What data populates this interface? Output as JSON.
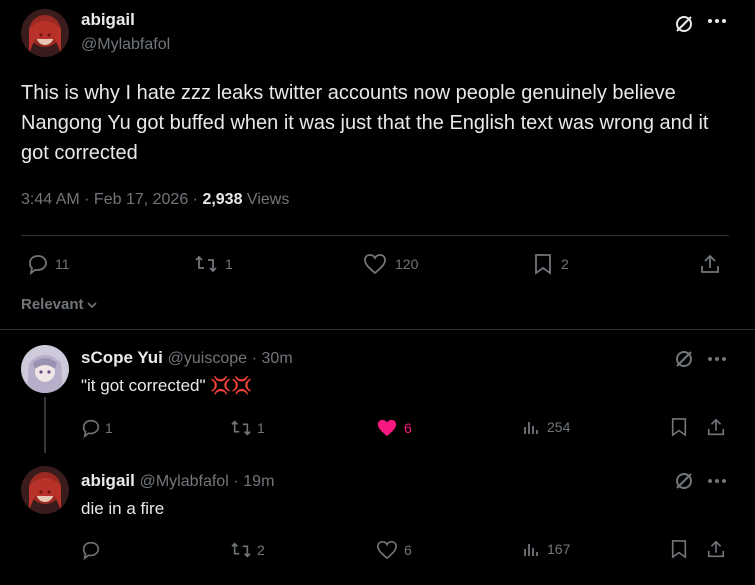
{
  "main_post": {
    "author_name": "abigail",
    "author_handle": "@Mylabfafol",
    "text": "This is why I hate zzz leaks twitter accounts now people genuinely believe Nangong Yu got buffed when it was just that the English text was wrong and it got corrected",
    "timestamp": "3:44 AM · Feb 17, 2026 · ",
    "views_count": "2,938",
    "views_label": " Views",
    "actions": {
      "replies": "11",
      "reposts": "1",
      "likes": "120",
      "bookmarks": "2"
    }
  },
  "sort": {
    "label": "Relevant"
  },
  "replies": [
    {
      "author_name": "sCope Yui",
      "author_handle": "@yuiscope",
      "time": "· 30m",
      "text": "\"it got corrected\" 💢💢",
      "actions": {
        "replies": "1",
        "reposts": "1",
        "likes": "6",
        "views": "254"
      },
      "liked": true
    },
    {
      "author_name": "abigail",
      "author_handle": "@Mylabfafol",
      "time": "· 19m",
      "text": "die in a fire",
      "actions": {
        "replies": "",
        "reposts": "2",
        "likes": "6",
        "views": "167"
      },
      "liked": false
    }
  ],
  "colors": {
    "accent_like": "#f91880",
    "muted": "#71767b",
    "text": "#e7e9ea",
    "divider": "#2f3336"
  }
}
